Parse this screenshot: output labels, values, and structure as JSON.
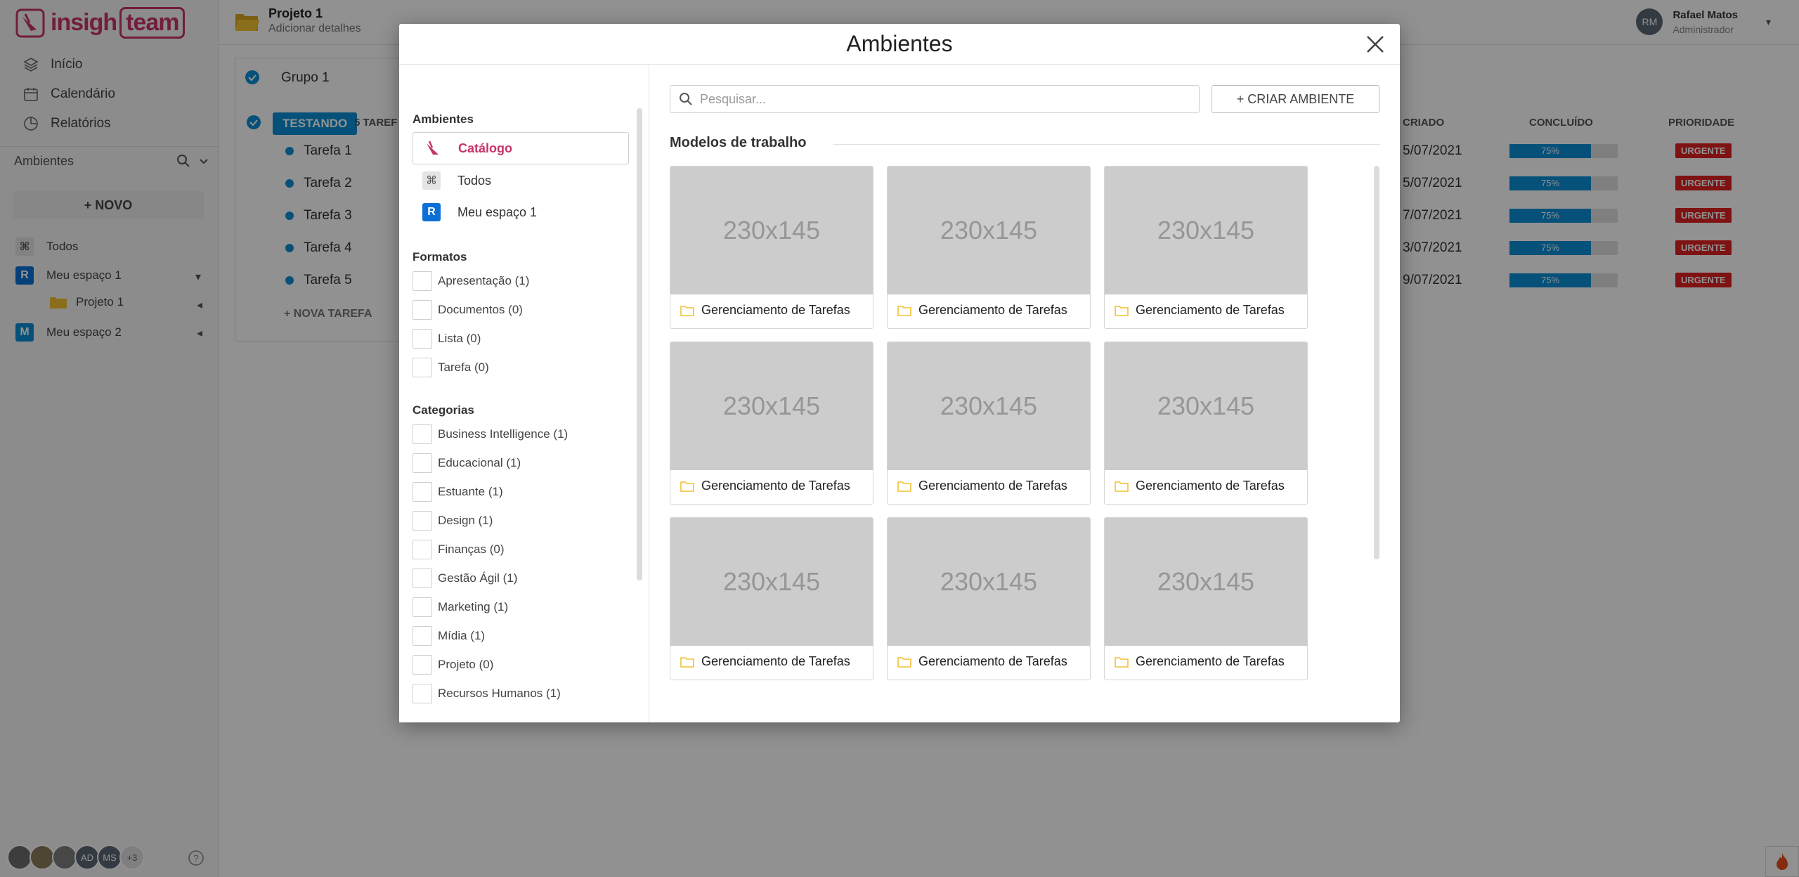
{
  "app": {
    "logo_text": "insigh",
    "logo_team": "team"
  },
  "sidebar": {
    "nav": [
      {
        "label": "Início"
      },
      {
        "label": "Calendário"
      },
      {
        "label": "Relatórios"
      }
    ],
    "section_title": "Ambientes",
    "new_button": "+ NOVO",
    "spaces": [
      {
        "label": "Todos",
        "icon": "⌘"
      },
      {
        "label": "Meu espaço 1",
        "letter": "R",
        "color": "#0b6fd6"
      },
      {
        "label": "Projeto 1"
      },
      {
        "label": "Meu espaço 2",
        "letter": "M",
        "color": "#0b8fd6"
      }
    ],
    "avatars": [
      "AD",
      "MS"
    ],
    "avatar_more": "+3"
  },
  "header": {
    "title": "Projeto 1",
    "subtitle": "Adicionar detalhes"
  },
  "user": {
    "initials": "RM",
    "name": "Rafael Matos",
    "role": "Administrador"
  },
  "board": {
    "group": "Grupo 1",
    "status": "TESTANDO",
    "count": "5 TAREF",
    "columns": {
      "created": "CRIADO",
      "done": "CONCLUÍDO",
      "priority": "PRIORIDADE"
    },
    "tasks": [
      {
        "name": "Tarefa 1",
        "date": "5/07/2021",
        "progress": "75%",
        "priority": "URGENTE"
      },
      {
        "name": "Tarefa 2",
        "date": "5/07/2021",
        "progress": "75%",
        "priority": "URGENTE"
      },
      {
        "name": "Tarefa 3",
        "date": "7/07/2021",
        "progress": "75%",
        "priority": "URGENTE"
      },
      {
        "name": "Tarefa 4",
        "date": "3/07/2021",
        "progress": "75%",
        "priority": "URGENTE"
      },
      {
        "name": "Tarefa 5",
        "date": "9/07/2021",
        "progress": "75%",
        "priority": "URGENTE"
      }
    ],
    "new_task": "+ NOVA TAREFA"
  },
  "modal": {
    "title": "Ambientes",
    "left": {
      "ambientes_title": "Ambientes",
      "items": [
        {
          "label": "Catálogo"
        },
        {
          "label": "Todos",
          "icon": "⌘"
        },
        {
          "label": "Meu espaço 1",
          "letter": "R"
        }
      ],
      "formatos_title": "Formatos",
      "formatos": [
        "Apresentação (1)",
        "Documentos (0)",
        "Lista (0)",
        "Tarefa (0)"
      ],
      "categorias_title": "Categorias",
      "categorias": [
        "Business Intelligence (1)",
        "Educacional (1)",
        "Estuante (1)",
        "Design (1)",
        "Finanças (0)",
        "Gestão Ágil (1)",
        "Marketing (1)",
        "Mídia (1)",
        "Projeto (0)",
        "Recursos Humanos (1)"
      ]
    },
    "search_placeholder": "Pesquisar...",
    "create_button": "+ CRIAR AMBIENTE",
    "section_title": "Modelos de trabalho",
    "cards": [
      {
        "img": "230x145",
        "label": "Gerenciamento de Tarefas"
      },
      {
        "img": "230x145",
        "label": "Gerenciamento de Tarefas"
      },
      {
        "img": "230x145",
        "label": "Gerenciamento de Tarefas"
      },
      {
        "img": "230x145",
        "label": "Gerenciamento de Tarefas"
      },
      {
        "img": "230x145",
        "label": "Gerenciamento de Tarefas"
      },
      {
        "img": "230x145",
        "label": "Gerenciamento de Tarefas"
      },
      {
        "img": "230x145",
        "label": "Gerenciamento de Tarefas"
      },
      {
        "img": "230x145",
        "label": "Gerenciamento de Tarefas"
      },
      {
        "img": "230x145",
        "label": "Gerenciamento de Tarefas"
      }
    ]
  },
  "colors": {
    "brand": "#c8346a",
    "accent": "#0b8fd6",
    "urgent": "#e02020",
    "folder": "#f2c230"
  },
  "icons": [
    "layers-icon",
    "calendar-icon",
    "chart-icon",
    "search-icon",
    "chevron-down-icon",
    "folder-icon",
    "close-icon",
    "help-icon",
    "fire-icon"
  ]
}
